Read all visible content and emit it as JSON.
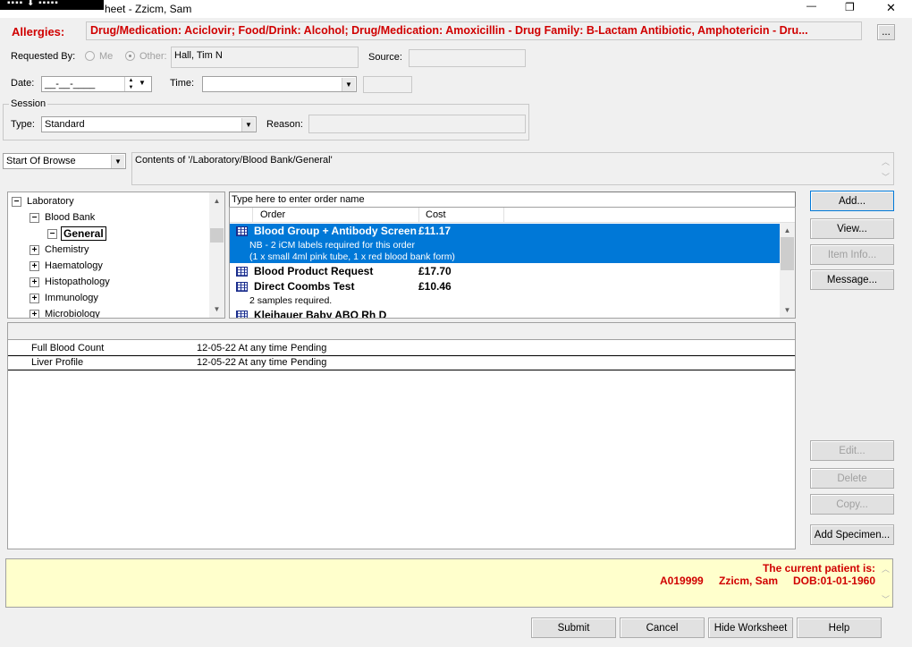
{
  "window": {
    "title": "heet - Zzicm, Sam",
    "minimize_glyph": "—",
    "restore_glyph": "❐",
    "close_glyph": "✕"
  },
  "allergies": {
    "label": "Allergies:",
    "text": "Drug/Medication: Aciclovir; Food/Drink: Alcohol; Drug/Medication: Amoxicillin - Drug Family: B-Lactam Antibiotic, Amphotericin - Dru...",
    "more_button": "..."
  },
  "requested_by": {
    "label": "Requested By:",
    "option_me": "Me",
    "option_other": "Other:",
    "value": "Hall, Tim N",
    "source_label": "Source:"
  },
  "date": {
    "label": "Date:",
    "value": "__-__-____",
    "time_label": "Time:"
  },
  "session": {
    "group_label": "Session",
    "type_label": "Type:",
    "type_value": "Standard",
    "reason_label": "Reason:"
  },
  "browse": {
    "select_value": "Start Of Browse",
    "contents_text": "Contents of '/Laboratory/Blood Bank/General'"
  },
  "tree": {
    "items": [
      {
        "label": "Laboratory",
        "expander": "−"
      },
      {
        "label": "Blood Bank",
        "expander": "−"
      },
      {
        "label": "General",
        "expander": "−"
      },
      {
        "label": "Chemistry",
        "expander": "+"
      },
      {
        "label": "Haematology",
        "expander": "+"
      },
      {
        "label": "Histopathology",
        "expander": "+"
      },
      {
        "label": "Immunology",
        "expander": "+"
      },
      {
        "label": "Microbiology",
        "expander": "+"
      }
    ]
  },
  "orders": {
    "search_placeholder": "Type here to enter order name",
    "col_order": "Order",
    "col_cost": "Cost",
    "rows": [
      {
        "name": "Blood Group + Antibody Screen",
        "cost": "£11.17",
        "note1": "NB - 2 iCM labels required for this order",
        "note2": "(1 x small 4ml pink tube, 1 x red blood bank form)"
      },
      {
        "name": "Blood Product Request",
        "cost": "£17.70"
      },
      {
        "name": "Direct Coombs Test",
        "cost": "£10.46",
        "note1": "2 samples required."
      },
      {
        "name": "Kleihauer Baby ABO Rh D",
        "cost": ""
      }
    ]
  },
  "selected_orders": [
    {
      "name": "Full Blood Count",
      "when": "12-05-22 At any time",
      "status": "Pending"
    },
    {
      "name": "Liver Profile",
      "when": "12-05-22 At any time",
      "status": "Pending"
    }
  ],
  "side_buttons": {
    "add": "Add...",
    "view": "View...",
    "item_info": "Item Info...",
    "message": "Message...",
    "edit": "Edit...",
    "delete": "Delete",
    "copy": "Copy...",
    "add_specimen": "Add Specimen..."
  },
  "patient_banner": {
    "line1": "The current patient is:",
    "id": "A019999",
    "name": "Zzicm, Sam",
    "dob": "DOB:01-01-1960"
  },
  "bottom_buttons": {
    "submit": "Submit",
    "cancel": "Cancel",
    "hide_worksheet": "Hide Worksheet",
    "help": "Help"
  },
  "colors": {
    "allergy_red": "#d00000",
    "selection_blue": "#0078d7",
    "banner_yellow": "#ffffcc"
  }
}
